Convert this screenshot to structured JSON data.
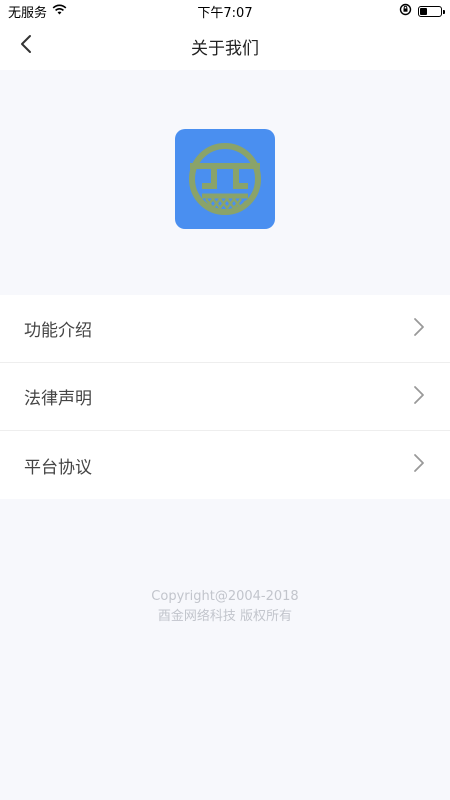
{
  "status_bar": {
    "carrier": "无服务",
    "time": "下午7:07",
    "battery_level": 0.35
  },
  "nav": {
    "title": "关于我们"
  },
  "menu": {
    "items": [
      {
        "label": "功能介绍"
      },
      {
        "label": "法律声明"
      },
      {
        "label": "平台协议"
      }
    ]
  },
  "footer": {
    "copyright": "Copyright@2004-2018",
    "company": "酉金网络科技 版权所有"
  },
  "colors": {
    "logo_background": "#4a8ff0",
    "logo_mark": "#8aa36a"
  },
  "icons": [
    "wifi-icon",
    "lock-rotation-icon",
    "battery-icon",
    "back-arrow-icon",
    "chevron-right-icon"
  ]
}
